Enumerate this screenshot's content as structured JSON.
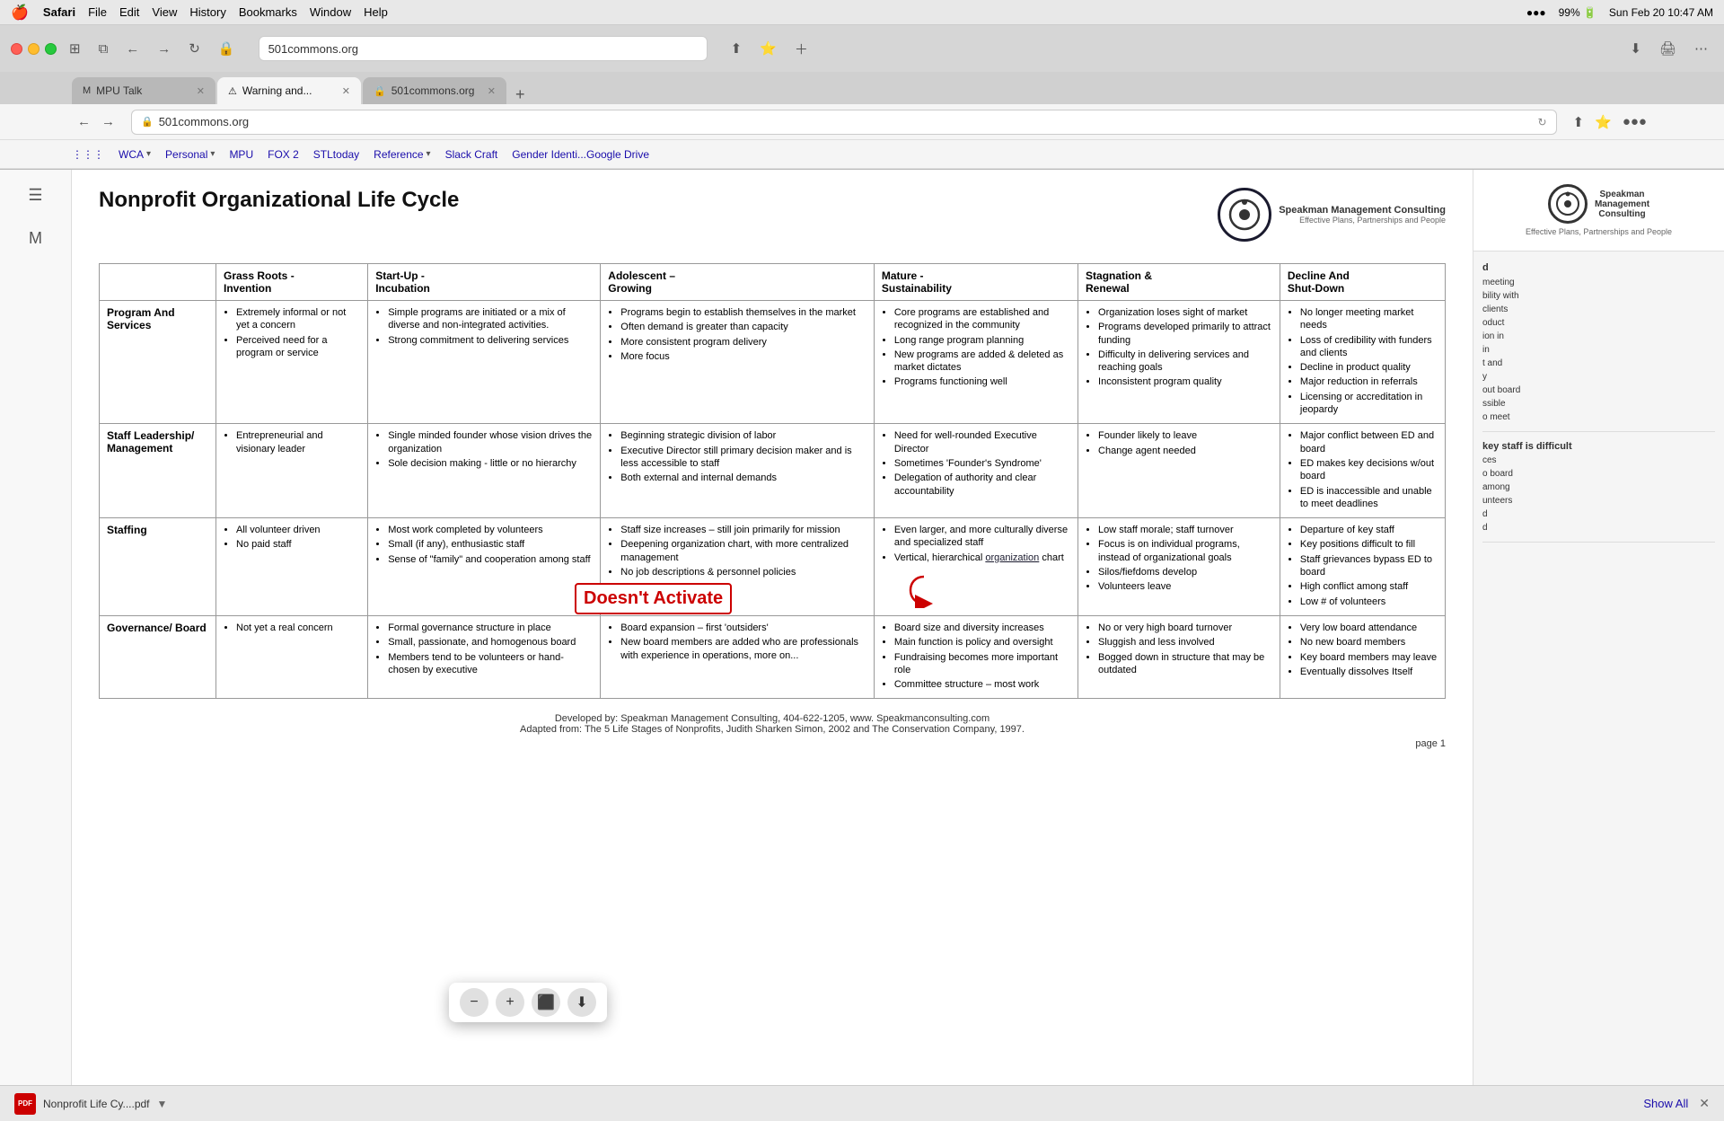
{
  "os": {
    "menubar": {
      "apple": "🍎",
      "items": [
        "Safari",
        "File",
        "Edit",
        "View",
        "History",
        "Bookmarks",
        "Window",
        "Help"
      ],
      "right_items": [
        "●●●",
        "10:47 AM",
        "Sun Feb 20"
      ]
    }
  },
  "browser": {
    "tabs": [
      {
        "id": "mpu-talk",
        "label": "MPU Talk",
        "icon": "M",
        "active": false
      },
      {
        "id": "warning",
        "label": "Warning and...",
        "icon": "⚠",
        "active": true
      },
      {
        "id": "501commons",
        "label": "501commons.org",
        "icon": "🔒",
        "active": false
      }
    ],
    "address": "501commons.org",
    "bookmarks": [
      {
        "label": "WCA",
        "dropdown": true
      },
      {
        "label": "Personal",
        "dropdown": true
      },
      {
        "label": "MPU"
      },
      {
        "label": "FOX 2"
      },
      {
        "label": "STLtoday"
      },
      {
        "label": "Reference",
        "dropdown": true
      },
      {
        "label": "Slack Craft"
      },
      {
        "label": "Gender Identi...Google Drive"
      }
    ],
    "toolbar_buttons": [
      "⊞",
      "←",
      "→",
      "⟳",
      "🔒",
      "☁",
      "▣",
      "⬇",
      "📋",
      "📑",
      "📋",
      "➕"
    ]
  },
  "pdf": {
    "title": "Nonprofit Organizational Life Cycle",
    "logo_company": "Speakman Management Consulting",
    "logo_tagline": "Effective Plans, Partnerships and People",
    "footer_line1": "Developed by: Speakman Management Consulting, 404-622-1205, www. Speakmanconsulting.com",
    "footer_line2": "Adapted from: The 5 Life Stages of Nonprofits, Judith Sharken Simon, 2002 and The Conservation Company, 1997.",
    "page": "page 1",
    "columns": [
      "Grass Roots  -  Invention",
      "Start-Up  -  Incubation",
      "Adolescent – Growing",
      "Mature - Sustainability",
      "Stagnation & Renewal",
      "Decline And Shut-Down"
    ],
    "row_headers": [
      "Program And Services",
      "Staff Leadership/ Management",
      "Staffing",
      "Governance/ Board"
    ],
    "cells": {
      "program_grassroots": [
        "Extremely informal or not yet a concern",
        "Perceived need for a program or service"
      ],
      "program_startup": [
        "Simple programs are initiated or a mix of diverse and non-integrated activities.",
        "Strong commitment to delivering services"
      ],
      "program_adolescent": [
        "Programs begin to establish themselves in the market",
        "Often demand is greater than capacity",
        "More consistent program delivery",
        "More focus"
      ],
      "program_mature": [
        "Core programs are established and recognized in the community",
        "Long range program planning",
        "New programs are added & deleted as market dictates",
        "Programs functioning well"
      ],
      "program_stagnation": [
        "Organization loses sight of market",
        "Programs developed primarily to attract funding",
        "Difficulty in delivering services and reaching goals",
        "Inconsistent program quality"
      ],
      "program_decline": [
        "No longer meeting market needs",
        "Loss of credibility with funders and clients",
        "Decline in product quality",
        "Major reduction in referrals",
        "Licensing or accreditation in jeopardy"
      ],
      "staff_grassroots": [
        "Entrepreneurial and visionary leader"
      ],
      "staff_startup": [
        "Single minded founder whose vision drives the organization",
        "Sole decision making - little or no hierarchy"
      ],
      "staff_adolescent": [
        "Beginning strategic division of labor",
        "Executive Director still primary decision maker and is less accessible to staff",
        "Both external and internal demands"
      ],
      "staff_mature": [
        "Need for well-rounded Executive Director",
        "Sometimes 'Founder's Syndrome'",
        "Delegation of authority and clear accountability"
      ],
      "staff_stagnation": [
        "Founder likely to leave",
        "Change agent needed"
      ],
      "staff_decline": [
        "Major conflict between ED and board",
        "ED makes key decisions w/out board",
        "ED is inaccessible and unable to meet deadlines"
      ],
      "staffing_grassroots": [
        "All volunteer driven",
        "No paid staff"
      ],
      "staffing_startup": [
        "Most work completed by volunteers",
        "Small (if any), enthusiastic staff",
        "Sense of 'family' and cooperation among staff"
      ],
      "staffing_adolescent": [
        "Staff size increases – still join primarily for mission",
        "Deepening organization chart, with more centralized management",
        "No job descriptions & personnel policies"
      ],
      "staffing_mature": [
        "Even larger, and more culturally diverse and specialized staff",
        "Vertical, hierarchical organization chart"
      ],
      "staffing_stagnation": [
        "Low staff morale; staff turnover",
        "Focus is on individual programs, instead of organizational goals",
        "Silos/fiefdoms develop",
        "Volunteers leave"
      ],
      "staffing_decline": [
        "Departure of key staff",
        "Key positions difficult to fill",
        "Staff grievances bypass ED to board",
        "High conflict among staff",
        "Low # of volunteers"
      ],
      "board_grassroots": [
        "Not yet a real concern"
      ],
      "board_startup": [
        "Formal governance structure in place",
        "Small, passionate, and homogenous board",
        "Members tend to be volunteers or hand-chosen by executive"
      ],
      "board_adolescent": [
        "Board expansion – first 'outsiders'",
        "New board members are added who are professionals with experience in operations, more on..."
      ],
      "board_mature": [
        "Board size and diversity increases",
        "Main function is policy and oversight",
        "Fundraising becomes more important role",
        "Committee structure – most work"
      ],
      "board_stagnation": [
        "No or very high board turnover",
        "Sluggish and less involved",
        "Bogged down in structure that may be outdated"
      ],
      "board_decline": [
        "Very low board attendance",
        "No new board members",
        "Key board members may leave",
        "Eventually dissolves Itself"
      ]
    }
  },
  "right_panel": {
    "logo_initial": "S",
    "company": "Speakman Management Consulting",
    "tagline": "Effective Plans, Partnerships and People",
    "sections": [
      {
        "title": "d",
        "items": [
          "meeting",
          "bility with clients",
          "oduct",
          "ion in",
          "in",
          "t and",
          "y",
          "out board",
          "ssible",
          "o meet"
        ]
      },
      {
        "title": "key staff is difficult",
        "items": [
          "ces",
          "o board",
          "among",
          "unteers",
          "d",
          "d"
        ]
      }
    ]
  },
  "overlay": {
    "doesnt_activate": "Doesn't Activate",
    "zoom_minus": "−",
    "zoom_plus": "+",
    "zoom_icon1": "⬇",
    "zoom_icon2": "📋"
  },
  "bottom_bar": {
    "filename": "Nonprofit Life Cy....pdf",
    "show_all": "Show All",
    "close": "✕",
    "battery": "99%",
    "time": "10:47 AM"
  }
}
